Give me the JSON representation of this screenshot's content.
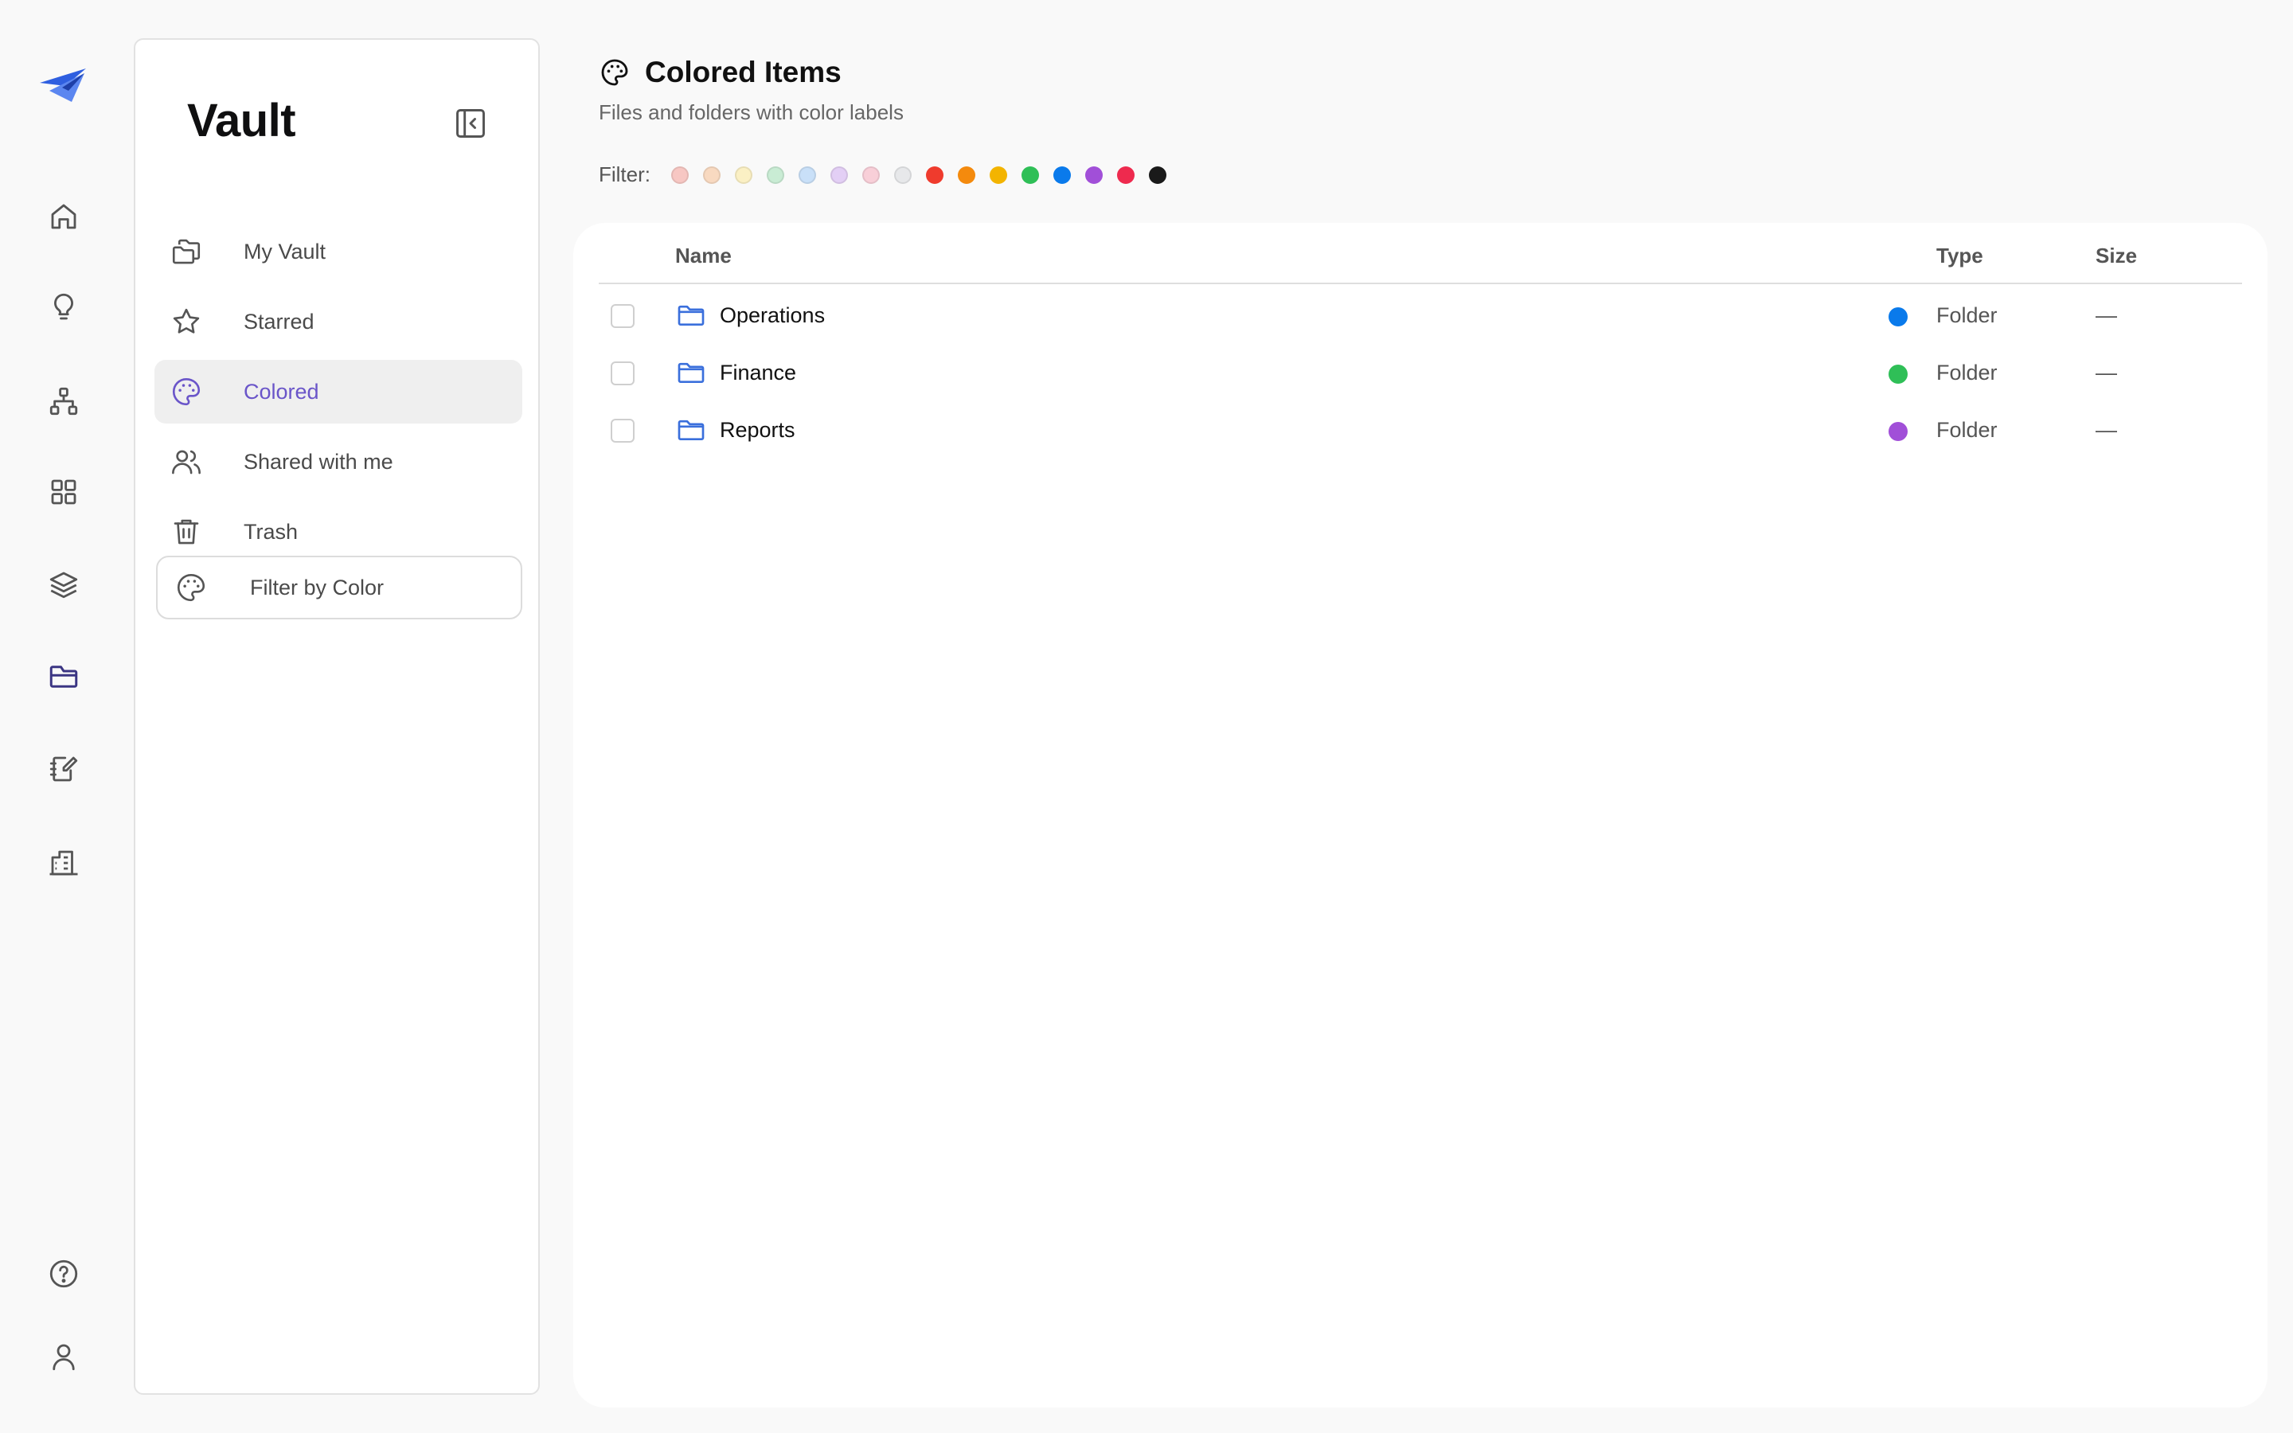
{
  "app": {
    "rail": {
      "items": [
        "home",
        "ideas",
        "hierarchy",
        "apps",
        "layers",
        "files",
        "notebook",
        "buildings"
      ],
      "bottom": [
        "help",
        "account"
      ]
    }
  },
  "sidebar": {
    "title": "Vault",
    "items": [
      {
        "label": "My Vault",
        "icon": "folders-icon",
        "active": false
      },
      {
        "label": "Starred",
        "icon": "star-icon",
        "active": false
      },
      {
        "label": "Colored",
        "icon": "palette-icon",
        "active": true
      },
      {
        "label": "Shared with me",
        "icon": "users-icon",
        "active": false
      },
      {
        "label": "Trash",
        "icon": "trash-icon",
        "active": false
      }
    ],
    "filter_button": "Filter by Color"
  },
  "header": {
    "title": "Colored Items",
    "subtitle": "Files and folders with color labels",
    "filter_label": "Filter:"
  },
  "filter_colors": [
    "#f7c7c3",
    "#f8d9c0",
    "#fbf0c4",
    "#c9ecd4",
    "#c9e0f8",
    "#e3cff5",
    "#f8cfd8",
    "#e7e8ea",
    "#ef3b2d",
    "#f48a0d",
    "#f3b400",
    "#2fbf57",
    "#0a7aeb",
    "#a14fd8",
    "#ee2a4e",
    "#1a1a1a"
  ],
  "table": {
    "columns": {
      "name": "Name",
      "type": "Type",
      "size": "Size"
    },
    "rows": [
      {
        "name": "Operations",
        "color": "#0a7aeb",
        "type": "Folder",
        "size": "—"
      },
      {
        "name": "Finance",
        "color": "#2fbf57",
        "type": "Folder",
        "size": "—"
      },
      {
        "name": "Reports",
        "color": "#a14fd8",
        "type": "Folder",
        "size": "—"
      }
    ]
  },
  "colors": {
    "accent": "#6a55c9",
    "folder_icon": "#3a6fdc",
    "active_nav_bg": "#efefef"
  }
}
